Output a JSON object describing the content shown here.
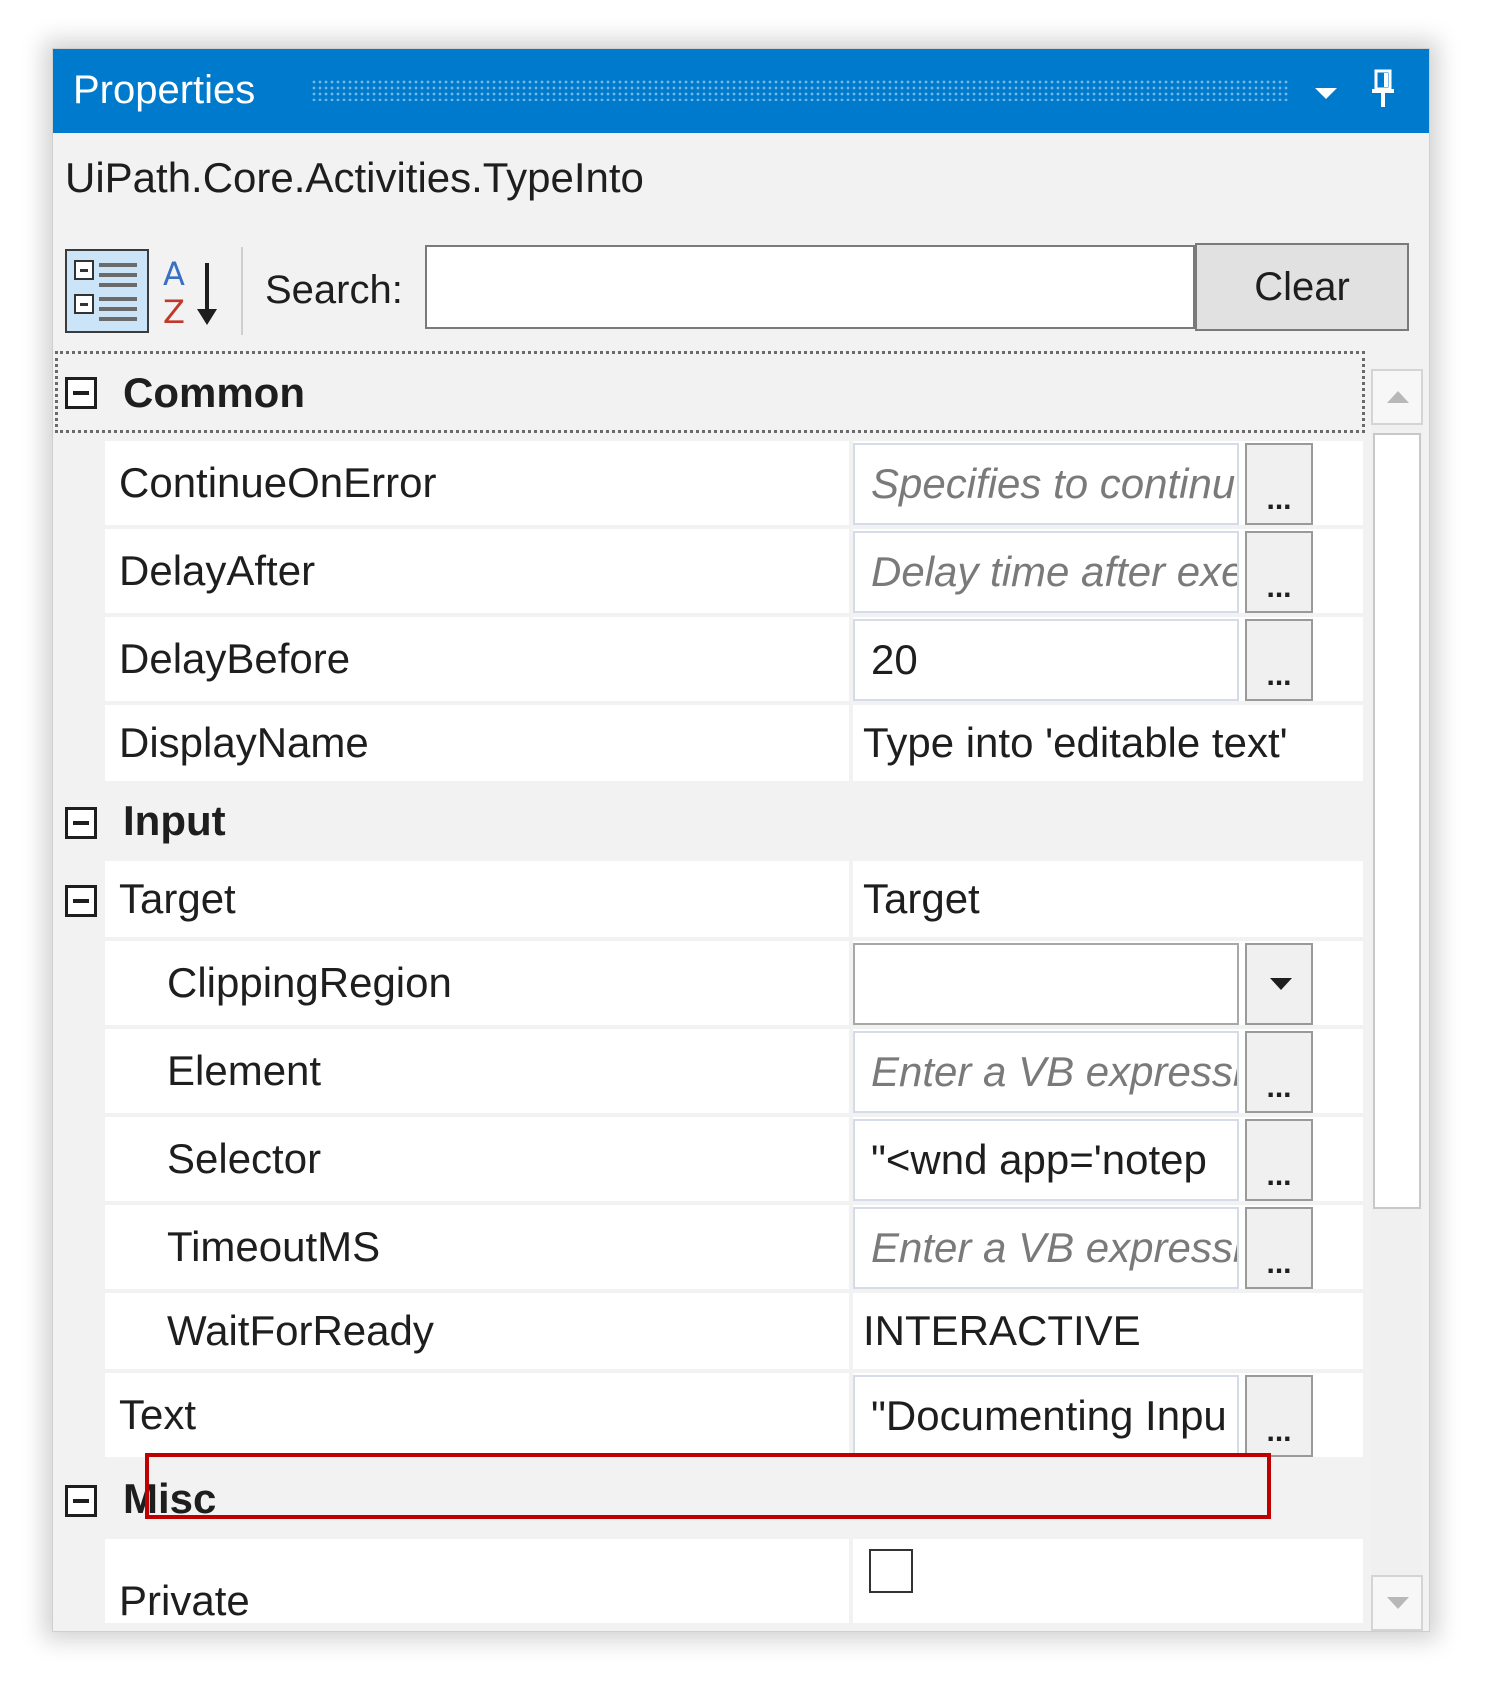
{
  "panel": {
    "title": "Properties",
    "type_name": "UiPath.Core.Activities.TypeInto"
  },
  "toolbar": {
    "categorized_icon": "categorized-view-icon",
    "alphabetical_icon": "sort-alphabetical-icon",
    "search_label": "Search:",
    "search_value": "",
    "clear_label": "Clear"
  },
  "categories": [
    {
      "label": "Common",
      "expanded": true
    },
    {
      "label": "Input",
      "expanded": true
    },
    {
      "label": "Misc",
      "expanded": true
    }
  ],
  "properties": {
    "continue_on_error": {
      "name": "ContinueOnError",
      "placeholder": "Specifies to continu"
    },
    "delay_after": {
      "name": "DelayAfter",
      "placeholder": "Delay time after exe"
    },
    "delay_before": {
      "name": "DelayBefore",
      "value": "20"
    },
    "display_name": {
      "name": "DisplayName",
      "value": "Type into 'editable text'"
    },
    "target": {
      "name": "Target",
      "value": "Target",
      "expanded": true
    },
    "clipping_region": {
      "name": "ClippingRegion",
      "value": ""
    },
    "element": {
      "name": "Element",
      "placeholder": "Enter a VB expressio"
    },
    "selector": {
      "name": "Selector",
      "value": "\"<wnd app='notep"
    },
    "timeout_ms": {
      "name": "TimeoutMS",
      "placeholder": "Enter a VB expressio"
    },
    "wait_for_ready": {
      "name": "WaitForReady",
      "value": "INTERACTIVE"
    },
    "text": {
      "name": "Text",
      "value": "\"Documenting Inpu"
    },
    "private": {
      "name": "Private",
      "checked": false
    }
  },
  "ellipsis_label": "...",
  "colors": {
    "title_bar": "#007acc",
    "panel_bg": "#f2f2f2",
    "highlight_border": "#c00000",
    "placeholder_text": "#7a7a7a"
  }
}
